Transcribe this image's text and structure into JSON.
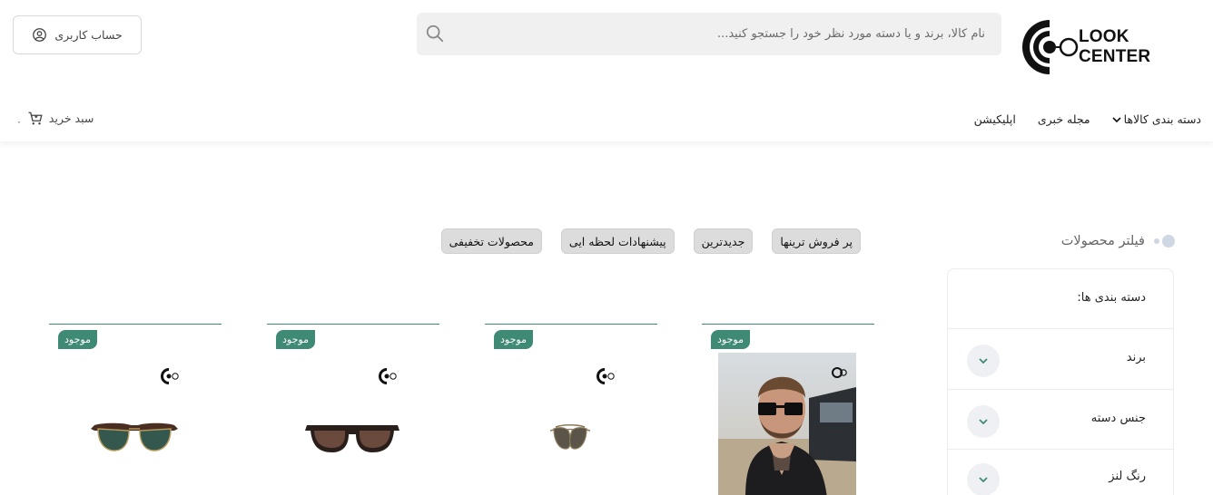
{
  "brand": {
    "logo_text": "LOOK CENTER",
    "accent": "#3f8a74"
  },
  "search": {
    "placeholder": "نام کالا، برند و یا دسته مورد نظر خود را جستجو کنید..."
  },
  "account": {
    "label": "حساب کاربری"
  },
  "nav": {
    "categories_label": "دسته بندی کالاها",
    "magazine_label": "مجله خبری",
    "app_label": "اپلیکیشن"
  },
  "cart": {
    "label": "سبد خرید",
    "count": "۰"
  },
  "filter": {
    "title": "فیلتر محصولات",
    "rows": [
      {
        "label": "دسته بندی ها:"
      },
      {
        "label": "برند"
      },
      {
        "label": "جنس دسته"
      },
      {
        "label": "رنگ لنز"
      }
    ]
  },
  "tabs": [
    {
      "label": "پر فروش ترینها"
    },
    {
      "label": "جدیدترین"
    },
    {
      "label": "پیشنهادات لحظه ایی"
    },
    {
      "label": "محصولات تخفیفی"
    }
  ],
  "products": [
    {
      "badge": "موجود",
      "image": "model-photo"
    },
    {
      "badge": "موجود",
      "image": "aviator-sunglasses"
    },
    {
      "badge": "موجود",
      "image": "square-sunglasses"
    },
    {
      "badge": "موجود",
      "image": "clubmaster-sunglasses"
    }
  ]
}
